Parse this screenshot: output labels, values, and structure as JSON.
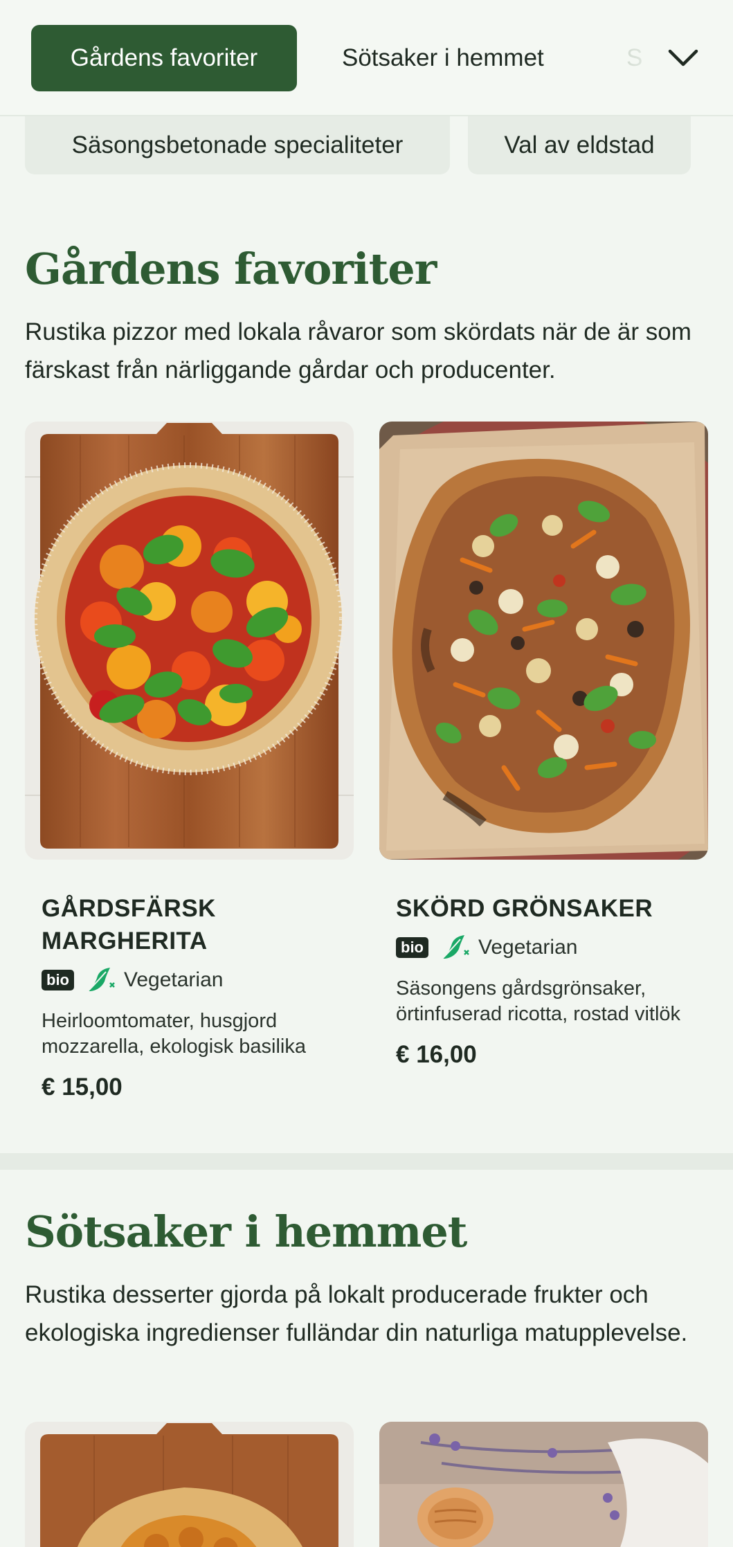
{
  "nav": {
    "tabs": [
      {
        "label": "Gårdens favoriter",
        "active": true
      },
      {
        "label": "Sötsaker i hemmet",
        "active": false
      },
      {
        "label": "S",
        "active": false
      }
    ],
    "expand_icon": "chevron-down-icon",
    "chips": [
      "Säsongsbetonade specialiteter",
      "Val av eldstad"
    ]
  },
  "sections": [
    {
      "title": "Gårdens favoriter",
      "description": "Rustika pizzor med lokala råvaror som skördats när de är som färskast från närliggande gårdar och producenter.",
      "products": [
        {
          "name": "Gårdsfärsk Margherita",
          "badge": "bio",
          "diet_icon": "leaf-icon",
          "diet": "Vegetarian",
          "description": "Heirloomtomater, husgjord mozzarella, ekologisk basilika",
          "price": "€ 15,00"
        },
        {
          "name": "Skörd grönsaker",
          "badge": "bio",
          "diet_icon": "leaf-icon",
          "diet": "Vegetarian",
          "description": "Säsongens gårdsgrönsaker, örtinfuserad ricotta, rostad vitlök",
          "price": "€ 16,00"
        }
      ]
    },
    {
      "title": "Sötsaker i hemmet",
      "description": "Rustika desserter gjorda på lokalt producerade frukter och ekologiska ingredienser fulländar din naturliga matupplevelse."
    }
  ],
  "colors": {
    "brand_green": "#2e5b33",
    "background": "#f2f6f1",
    "leaf_green": "#1aa866"
  }
}
